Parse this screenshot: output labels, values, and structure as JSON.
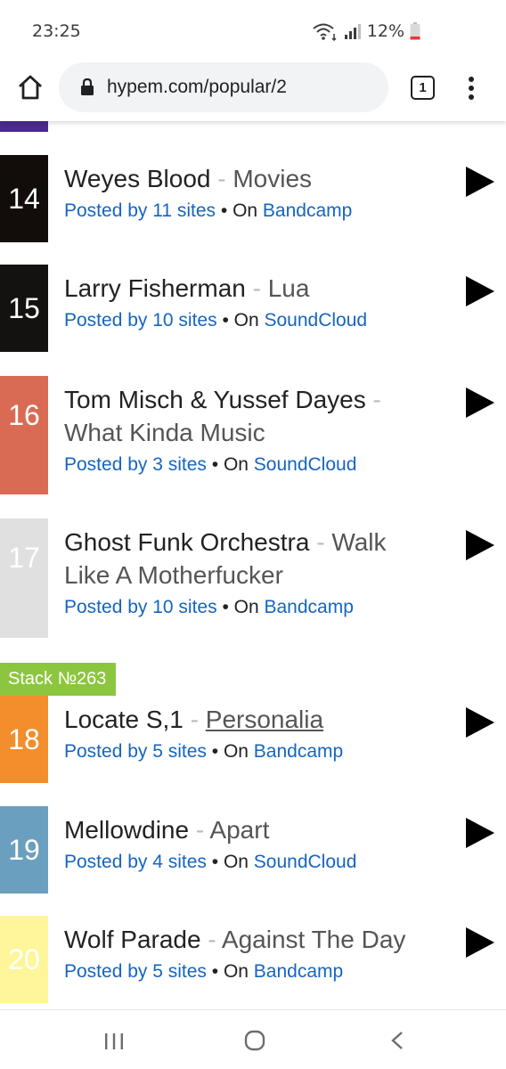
{
  "status_bar": {
    "time": "23:25",
    "battery": "12%"
  },
  "browser": {
    "url": "hypem.com/popular/2",
    "tab_count": "1"
  },
  "tracks": [
    {
      "rank": "14",
      "artist": "Weyes Blood",
      "sep": " - ",
      "song": "Movies",
      "posted_by": "Posted by 11 sites",
      "on": " • On ",
      "source": "Bandcamp",
      "color": "#120d0b"
    },
    {
      "rank": "15",
      "artist": "Larry Fisherman",
      "sep": " - ",
      "song": "Lua",
      "posted_by": "Posted by 10 sites",
      "on": " • On ",
      "source": "SoundCloud",
      "color": "#141210"
    },
    {
      "rank": "16",
      "artist": "Tom Misch & Yussef Dayes",
      "sep": " - ",
      "song": "What Kinda Music",
      "posted_by": "Posted by 3 sites",
      "on": " • On ",
      "source": "SoundCloud",
      "color": "#d96b55"
    },
    {
      "rank": "17",
      "artist": "Ghost Funk Orchestra",
      "sep": " - ",
      "song": "Walk Like A Motherfucker",
      "posted_by": "Posted by 10 sites",
      "on": " • On ",
      "source": "Bandcamp",
      "color": "#e0e0e0"
    },
    {
      "rank": "18",
      "artist": "Locate S,1",
      "sep": " - ",
      "song": "Personalia",
      "posted_by": "Posted by 5 sites",
      "on": " • On ",
      "source": "Bandcamp",
      "color": "#f28e2b"
    },
    {
      "rank": "19",
      "artist": "Mellowdine",
      "sep": " - ",
      "song": "Apart",
      "posted_by": "Posted by 4 sites",
      "on": " • On ",
      "source": "SoundCloud",
      "color": "#6a9fbf"
    },
    {
      "rank": "20",
      "artist": "Wolf Parade",
      "sep": " - ",
      "song": "Against The Day",
      "posted_by": "Posted by 5 sites",
      "on": " • On ",
      "source": "Bandcamp",
      "color": "#fff59a"
    }
  ],
  "stack_badge": "Stack №263",
  "colors": {
    "link": "#1565c0",
    "stack_badge": "#8cc63f",
    "top_stub": "#4b2a8c"
  },
  "icons": {
    "home": "home-icon",
    "lock": "lock-icon",
    "menu": "more-vert-icon",
    "play": "play-icon",
    "nav_recent": "recent-apps-icon",
    "nav_home": "home-circle-icon",
    "nav_back": "back-icon"
  }
}
